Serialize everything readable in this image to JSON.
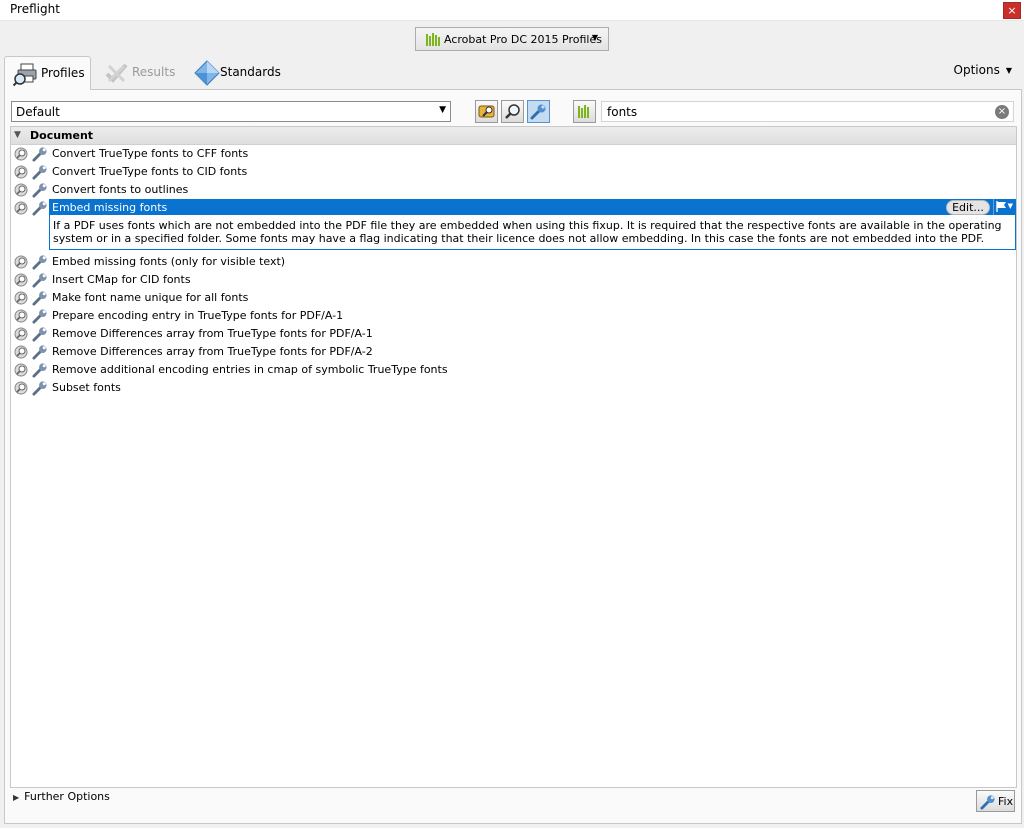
{
  "window": {
    "title": "Preflight",
    "close_glyph": "×"
  },
  "library": {
    "label": "Acrobat Pro DC 2015 Profiles",
    "icon": "library-bars-icon"
  },
  "tabs": [
    {
      "label": "Profiles",
      "icon": "printer-magnifier-icon",
      "active": true
    },
    {
      "label": "Results",
      "icon": "results-check-icon",
      "active": false
    },
    {
      "label": "Standards",
      "icon": "diamond-icon",
      "active": false
    }
  ],
  "options": {
    "label": "Options"
  },
  "profile_select": {
    "value": "Default"
  },
  "toolbar": {
    "buttons": [
      {
        "name": "profiles-view",
        "icon": "profile-icon"
      },
      {
        "name": "checks-view",
        "icon": "magnifier-icon"
      },
      {
        "name": "fixups-view",
        "icon": "wrench-icon",
        "active": true
      }
    ]
  },
  "search": {
    "value": "fonts",
    "clear_glyph": "×"
  },
  "tree": {
    "group": "Document",
    "items": [
      {
        "label": "Convert TrueType fonts to CFF fonts"
      },
      {
        "label": "Convert TrueType fonts to CID fonts"
      },
      {
        "label": "Convert fonts to outlines"
      },
      {
        "label": "Embed missing fonts",
        "selected": true
      },
      {
        "label": "Embed missing fonts (only for visible text)"
      },
      {
        "label": "Insert CMap for CID fonts"
      },
      {
        "label": "Make font name unique for all fonts"
      },
      {
        "label": "Prepare encoding entry in TrueType fonts for PDF/A-1"
      },
      {
        "label": "Remove Differences array from TrueType fonts for PDF/A-1"
      },
      {
        "label": "Remove Differences array from TrueType fonts for PDF/A-2"
      },
      {
        "label": "Remove additional encoding entries in cmap of symbolic TrueType fonts"
      },
      {
        "label": "Subset fonts"
      }
    ],
    "selected_description": "If a PDF uses fonts which are not embedded into the PDF file they are embedded when using this fixup. It is required that the respective fonts are available in the operating system or in a specified folder. Some fonts may have a flag indicating that their licence does not allow embedding. In this case the fonts are not embedded into the PDF.",
    "edit_label": "Edit..."
  },
  "further_options": {
    "label": "Further Options"
  },
  "fix_button": {
    "label": "Fix"
  },
  "colors": {
    "selection": "#0a72cf",
    "close": "#c9302c",
    "library_icon": "#7cb51c"
  }
}
